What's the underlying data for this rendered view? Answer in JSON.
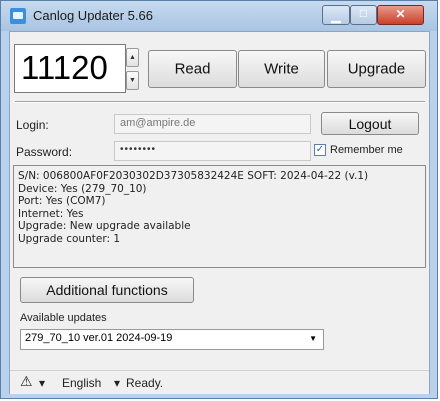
{
  "window": {
    "title": "Canlog Updater 5.66",
    "min_icon": "minimize-icon",
    "max_icon": "maximize-icon",
    "close_glyph": "✕"
  },
  "serial_box": {
    "value": "11120",
    "up": "▲",
    "down": "▼"
  },
  "toolbar": {
    "read": "Read",
    "write": "Write",
    "upgrade": "Upgrade"
  },
  "login": {
    "login_label": "Login:",
    "login_value": "am@ampire.de",
    "password_label": "Password:",
    "password_value": "••••••••",
    "logout": "Logout",
    "remember_label": "Remember me",
    "remember_checked": true,
    "check_glyph": "✓"
  },
  "status_lines": [
    "S/N: 006800AF0F2030302D37305832424E  SOFT: 2024-04-22 (v.1)",
    "Device: Yes (279_70_10)",
    "Port: Yes (COM7)",
    "Internet: Yes",
    "Upgrade:  New upgrade available",
    "Upgrade counter:  1"
  ],
  "additional_button": "Additional functions",
  "updates": {
    "label": "Available updates",
    "selected": "279_70_10  ver.01   2024-09-19",
    "arrow": "▼"
  },
  "statusbar": {
    "warning_glyph": "⚠",
    "dropdown_glyph": "▾",
    "language": "English",
    "lang_arrow": "▾",
    "state": "Ready."
  }
}
